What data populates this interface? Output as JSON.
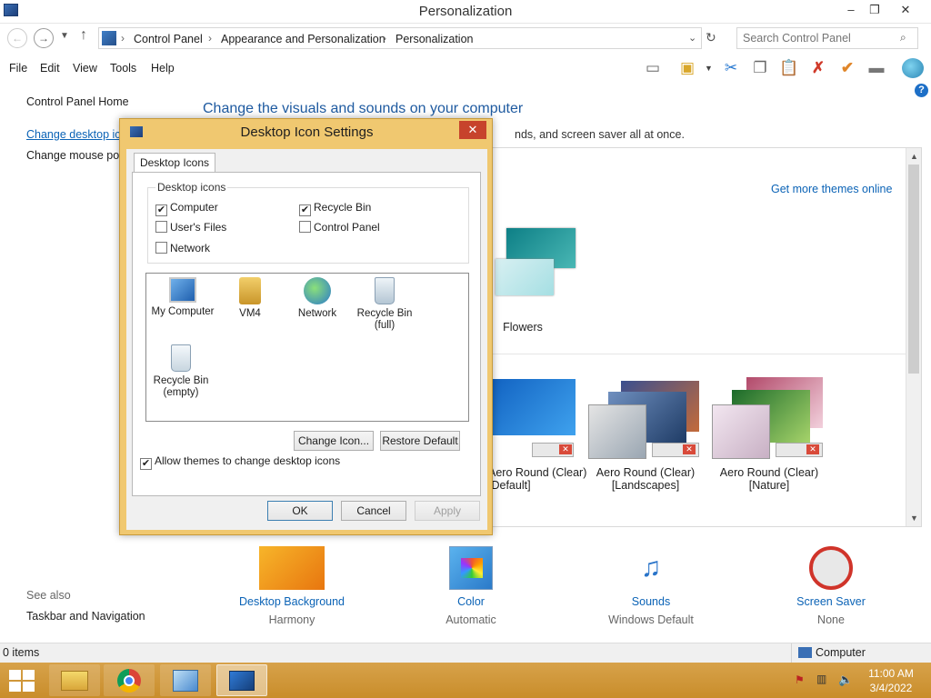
{
  "window": {
    "title": "Personalization",
    "controls": {
      "minimize": "–",
      "maximize": "❐",
      "close": "✕"
    }
  },
  "address": {
    "crumbs": [
      "Control Panel",
      "Appearance and Personalization",
      "Personalization"
    ],
    "search_placeholder": "Search Control Panel"
  },
  "menu": [
    "File",
    "Edit",
    "View",
    "Tools",
    "Help"
  ],
  "left": {
    "home": "Control Panel Home",
    "change_icons": "Change desktop icons",
    "change_pointers": "Change mouse pointers",
    "see_also": "See also",
    "taskbar": "Taskbar and Navigation"
  },
  "main": {
    "title": "Change the visuals and sounds on your computer",
    "desc_tail": "nds, and screen saver all at once.",
    "get_more": "Get more themes online",
    "themes": [
      {
        "label": "Flowers"
      },
      {
        "label": "Aero Round (Clear)\n[Default]",
        "line1": "Aero Round (Clear)",
        "line2": "[Default]"
      },
      {
        "line1": "Aero Round (Clear)",
        "line2": "[Landscapes]"
      },
      {
        "line1": "Aero Round (Clear)",
        "line2": "[Nature]"
      }
    ],
    "customize": [
      {
        "label": "Desktop Background",
        "sub": "Harmony"
      },
      {
        "label": "Color",
        "sub": "Automatic"
      },
      {
        "label": "Sounds",
        "sub": "Windows Default"
      },
      {
        "label": "Screen Saver",
        "sub": "None"
      }
    ]
  },
  "status": {
    "items": "0 items",
    "location": "Computer"
  },
  "taskbar": {
    "time": "11:00 AM",
    "date": "3/4/2022"
  },
  "dialog": {
    "title": "Desktop Icon Settings",
    "tab": "Desktop Icons",
    "group": "Desktop icons",
    "checkboxes": [
      {
        "label": "Computer",
        "checked": "✔"
      },
      {
        "label": "Recycle Bin",
        "checked": "✔"
      },
      {
        "label": "User's Files",
        "checked": ""
      },
      {
        "label": "Control Panel",
        "checked": ""
      },
      {
        "label": "Network",
        "checked": ""
      }
    ],
    "icons": [
      {
        "line1": "My Computer",
        "line2": ""
      },
      {
        "line1": "VM4",
        "line2": ""
      },
      {
        "line1": "Network",
        "line2": ""
      },
      {
        "line1": "Recycle Bin",
        "line2": "(full)"
      },
      {
        "line1": "Recycle Bin",
        "line2": "(empty)"
      }
    ],
    "change_icon": "Change Icon...",
    "restore_default": "Restore Default",
    "allow_themes": "Allow themes to change desktop icons",
    "allow_checked": "✔",
    "ok": "OK",
    "cancel": "Cancel",
    "apply": "Apply"
  }
}
